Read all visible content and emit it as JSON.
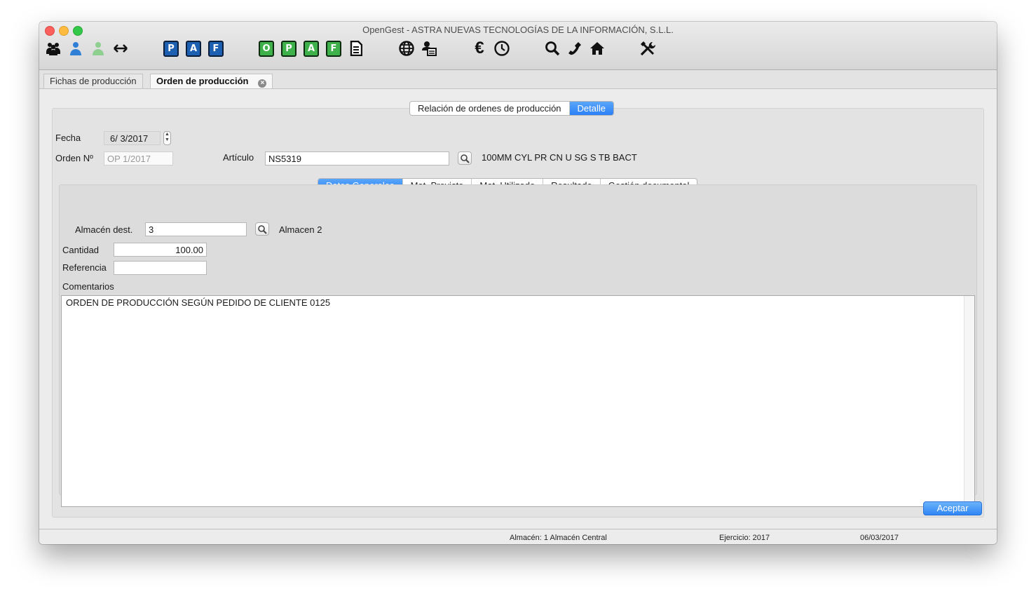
{
  "window": {
    "title": "OpenGest - ASTRA NUEVAS TECNOLOGÍAS DE LA INFORMACIÓN, S.L.L."
  },
  "toolbar": {
    "icons": [
      "users-group-icon",
      "user-blue-icon",
      "user-green-icon",
      "arrows-horizontal-icon",
      "p-blue-badge-icon",
      "a-blue-badge-icon",
      "f-blue-badge-icon",
      "o-green-badge-icon",
      "p-green-badge-icon",
      "a-green-badge-icon",
      "f-green-badge-icon",
      "document-list-icon",
      "globe-icon",
      "user-id-icon",
      "euro-icon",
      "clock-icon",
      "search-icon",
      "phone-icon",
      "home-icon",
      "tools-icon"
    ],
    "badges": {
      "p": "P",
      "a": "A",
      "f": "F",
      "o": "O"
    },
    "euro": "€"
  },
  "doc_tabs": [
    {
      "label": "Fichas de producción",
      "active": false
    },
    {
      "label": "Orden de producción",
      "active": true,
      "close_symbol": "×"
    }
  ],
  "view_switch": {
    "options": [
      "Relación de ordenes de producción",
      "Detalle"
    ],
    "selected": "Detalle"
  },
  "form": {
    "fecha_label": "Fecha",
    "fecha_value": "6/  3/2017",
    "orden_label": "Orden Nº",
    "orden_value": "OP 1/2017",
    "articulo_label": "Artículo",
    "articulo_value": "NS5319",
    "articulo_desc": "100MM CYL PR CN U SG S TB BACT"
  },
  "detail_tabs": {
    "options": [
      "Datos Generales",
      "Mat. Previsto",
      "Mat. Utilizado",
      "Resultado",
      "Gestión documental"
    ],
    "selected": "Datos Generales"
  },
  "general": {
    "almacen_label": "Almacén dest.",
    "almacen_value": "3",
    "almacen_name": "Almacen 2",
    "cantidad_label": "Cantidad",
    "cantidad_value": "100.00",
    "referencia_label": "Referencia",
    "referencia_value": "",
    "comentarios_label": "Comentarios",
    "comentarios_value": "ORDEN DE PRODUCCIÓN SEGÚN PEDIDO DE CLIENTE 0125"
  },
  "actions": {
    "accept_label": "Aceptar"
  },
  "status": {
    "almacen": "Almacén: 1 Almacén Central",
    "ejercicio": "Ejercicio: 2017",
    "fecha": "06/03/2017"
  },
  "colors": {
    "accent_blue": "#2b80f5",
    "badge_blue": "#1d5fb0",
    "badge_green": "#3fb14a",
    "user_blue": "#2f7fd6",
    "user_green": "#8fcf8f",
    "close_red": "#fc605c",
    "min_yellow": "#fdbc40",
    "max_green": "#34c84a"
  }
}
